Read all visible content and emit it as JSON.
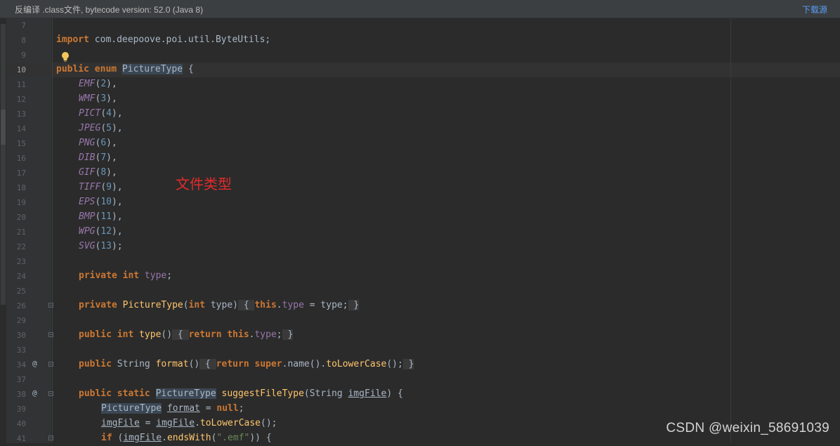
{
  "banner": {
    "text": "反编译 .class文件, bytecode version: 52.0 (Java 8)",
    "link": "下载源"
  },
  "lines": [
    {
      "n": "7"
    },
    {
      "n": "8",
      "text": "import com.deepoove.poi.util.ByteUtils;"
    },
    {
      "n": "9"
    },
    {
      "n": "10",
      "text": "public enum PictureType {"
    },
    {
      "n": "11",
      "text": "EMF(2),"
    },
    {
      "n": "12",
      "text": "WMF(3),"
    },
    {
      "n": "13",
      "text": "PICT(4),"
    },
    {
      "n": "14",
      "text": "JPEG(5),"
    },
    {
      "n": "15",
      "text": "PNG(6),"
    },
    {
      "n": "16",
      "text": "DIB(7),"
    },
    {
      "n": "17",
      "text": "GIF(8),"
    },
    {
      "n": "18",
      "text": "TIFF(9),"
    },
    {
      "n": "19",
      "text": "EPS(10),"
    },
    {
      "n": "20",
      "text": "BMP(11),"
    },
    {
      "n": "21",
      "text": "WPG(12),"
    },
    {
      "n": "22",
      "text": "SVG(13);"
    },
    {
      "n": "23"
    },
    {
      "n": "24",
      "text": "private int type;"
    },
    {
      "n": "25"
    },
    {
      "n": "26",
      "text": "private PictureType(int type) { this.type = type; }"
    },
    {
      "n": "29"
    },
    {
      "n": "30",
      "text": "public int type() { return this.type; }"
    },
    {
      "n": "33"
    },
    {
      "n": "34",
      "text": "public String format() { return super.name().toLowerCase(); }"
    },
    {
      "n": "37"
    },
    {
      "n": "38",
      "text": "public static PictureType suggestFileType(String imgFile) {"
    },
    {
      "n": "39",
      "text": "PictureType format = null;"
    },
    {
      "n": "40",
      "text": "imgFile = imgFile.toLowerCase();"
    },
    {
      "n": "41",
      "text": "if (imgFile.endsWith(\".emf\")) {"
    }
  ],
  "gutter_marks": {
    "34": "@",
    "38": "@"
  },
  "annotation": "文件类型",
  "watermark": "CSDN @weixin_58691039",
  "icons": {
    "intention": "lightbulb-icon",
    "fold": "fold-toggle-icon"
  },
  "colors": {
    "background": "#2b2b2b",
    "keyword": "#cc7832",
    "enum_constant": "#9876aa",
    "number": "#6897bb",
    "annotation": "#e32b2b",
    "link": "#589df6"
  }
}
